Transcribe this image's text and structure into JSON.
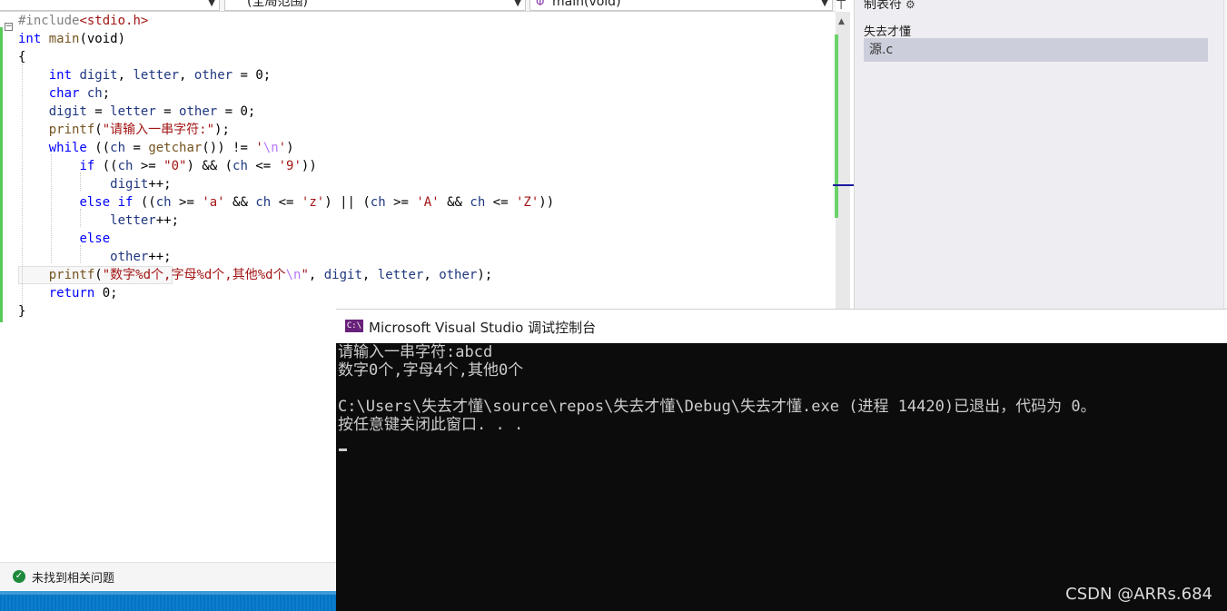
{
  "toolbar": {
    "scope_dropdown": "(全局范围)",
    "function_dropdown": "main(void)",
    "function_icon": "function-icon",
    "arrow_icon": "chevron-down-icon"
  },
  "code_lines": [
    {
      "parts": [
        {
          "t": "#include",
          "c": "pp"
        },
        {
          "t": "<stdio.h>",
          "c": "inc"
        }
      ]
    },
    {
      "parts": [
        {
          "t": "int",
          "c": "kw"
        },
        {
          "t": " "
        },
        {
          "t": "main",
          "c": "fn"
        },
        {
          "t": "(void)"
        }
      ]
    },
    {
      "parts": [
        {
          "t": "{"
        }
      ]
    },
    {
      "parts": [
        {
          "t": "    "
        },
        {
          "t": "int",
          "c": "kw"
        },
        {
          "t": " "
        },
        {
          "t": "digit",
          "c": "vr"
        },
        {
          "t": ", "
        },
        {
          "t": "letter",
          "c": "vr"
        },
        {
          "t": ", "
        },
        {
          "t": "other",
          "c": "vr"
        },
        {
          "t": " = 0;"
        }
      ]
    },
    {
      "parts": [
        {
          "t": "    "
        },
        {
          "t": "char",
          "c": "kw"
        },
        {
          "t": " "
        },
        {
          "t": "ch",
          "c": "vr"
        },
        {
          "t": ";"
        }
      ]
    },
    {
      "parts": [
        {
          "t": "    "
        },
        {
          "t": "digit",
          "c": "vr"
        },
        {
          "t": " = "
        },
        {
          "t": "letter",
          "c": "vr"
        },
        {
          "t": " = "
        },
        {
          "t": "other",
          "c": "vr"
        },
        {
          "t": " = 0;"
        }
      ]
    },
    {
      "parts": [
        {
          "t": "    "
        },
        {
          "t": "printf",
          "c": "fn"
        },
        {
          "t": "("
        },
        {
          "t": "\"请输入一串字符:\"",
          "c": "st"
        },
        {
          "t": ");"
        }
      ]
    },
    {
      "parts": [
        {
          "t": "    "
        },
        {
          "t": "while",
          "c": "kw"
        },
        {
          "t": " (("
        },
        {
          "t": "ch",
          "c": "vr"
        },
        {
          "t": " = "
        },
        {
          "t": "getchar",
          "c": "fn"
        },
        {
          "t": "()) != "
        },
        {
          "t": "'",
          "c": "st"
        },
        {
          "t": "\\n",
          "c": "es"
        },
        {
          "t": "'",
          "c": "st"
        },
        {
          "t": ")"
        }
      ]
    },
    {
      "parts": [
        {
          "t": "        "
        },
        {
          "t": "if",
          "c": "kw"
        },
        {
          "t": " (("
        },
        {
          "t": "ch",
          "c": "vr"
        },
        {
          "t": " >= "
        },
        {
          "t": "\"0\"",
          "c": "st"
        },
        {
          "t": ") && ("
        },
        {
          "t": "ch",
          "c": "vr"
        },
        {
          "t": " <= "
        },
        {
          "t": "'9'",
          "c": "st"
        },
        {
          "t": "))"
        }
      ]
    },
    {
      "parts": [
        {
          "t": "            "
        },
        {
          "t": "digit",
          "c": "vr"
        },
        {
          "t": "++;"
        }
      ]
    },
    {
      "parts": [
        {
          "t": "        "
        },
        {
          "t": "else",
          "c": "kw"
        },
        {
          "t": " "
        },
        {
          "t": "if",
          "c": "kw"
        },
        {
          "t": " (("
        },
        {
          "t": "ch",
          "c": "vr"
        },
        {
          "t": " >= "
        },
        {
          "t": "'a'",
          "c": "st"
        },
        {
          "t": " && "
        },
        {
          "t": "ch",
          "c": "vr"
        },
        {
          "t": " <= "
        },
        {
          "t": "'z'",
          "c": "st"
        },
        {
          "t": ") || ("
        },
        {
          "t": "ch",
          "c": "vr"
        },
        {
          "t": " >= "
        },
        {
          "t": "'A'",
          "c": "st"
        },
        {
          "t": " && "
        },
        {
          "t": "ch",
          "c": "vr"
        },
        {
          "t": " <= "
        },
        {
          "t": "'Z'",
          "c": "st"
        },
        {
          "t": "))"
        }
      ]
    },
    {
      "parts": [
        {
          "t": "            "
        },
        {
          "t": "letter",
          "c": "vr"
        },
        {
          "t": "++;"
        }
      ]
    },
    {
      "parts": [
        {
          "t": "        "
        },
        {
          "t": "else",
          "c": "kw"
        }
      ]
    },
    {
      "parts": [
        {
          "t": "            "
        },
        {
          "t": "other",
          "c": "vr"
        },
        {
          "t": "++;"
        }
      ]
    },
    {
      "parts": [
        {
          "t": "    "
        },
        {
          "t": "printf",
          "c": "fn"
        },
        {
          "t": "("
        },
        {
          "t": "\"数字%d个,字母%d个,其他%d个",
          "c": "st"
        },
        {
          "t": "\\n",
          "c": "es"
        },
        {
          "t": "\"",
          "c": "st"
        },
        {
          "t": ", "
        },
        {
          "t": "digit",
          "c": "vr"
        },
        {
          "t": ", "
        },
        {
          "t": "letter",
          "c": "vr"
        },
        {
          "t": ", "
        },
        {
          "t": "other",
          "c": "vr"
        },
        {
          "t": ");"
        }
      ]
    },
    {
      "parts": [
        {
          "t": "    "
        },
        {
          "t": "return",
          "c": "kw"
        },
        {
          "t": " 0;"
        }
      ]
    },
    {
      "parts": [
        {
          "t": "}"
        }
      ]
    }
  ],
  "right_panel": {
    "title": "制表符",
    "gear_icon": "gear-icon",
    "project": "失去才懂",
    "file": "源.c"
  },
  "console": {
    "icon_text": "C:\\",
    "title": "Microsoft Visual Studio 调试控制台",
    "lines": [
      "请输入一串字符:abcd",
      "数字0个,字母4个,其他0个",
      "",
      "C:\\Users\\失去才懂\\source\\repos\\失去才懂\\Debug\\失去才懂.exe (进程 14420)已退出，代码为 0。",
      "按任意键关闭此窗口. . ."
    ]
  },
  "status": {
    "issues": "未找到相关问题",
    "check_icon": "check-circle-icon"
  },
  "watermark": "CSDN @A⁠⁠⁠R⁠⁠R⁠s.684",
  "colors": {
    "keyword": "#0000ff",
    "string": "#a31515",
    "function": "#74531f",
    "variable": "#1f377f",
    "console_bg": "#0c0c0c",
    "statusbar": "#007acc"
  }
}
